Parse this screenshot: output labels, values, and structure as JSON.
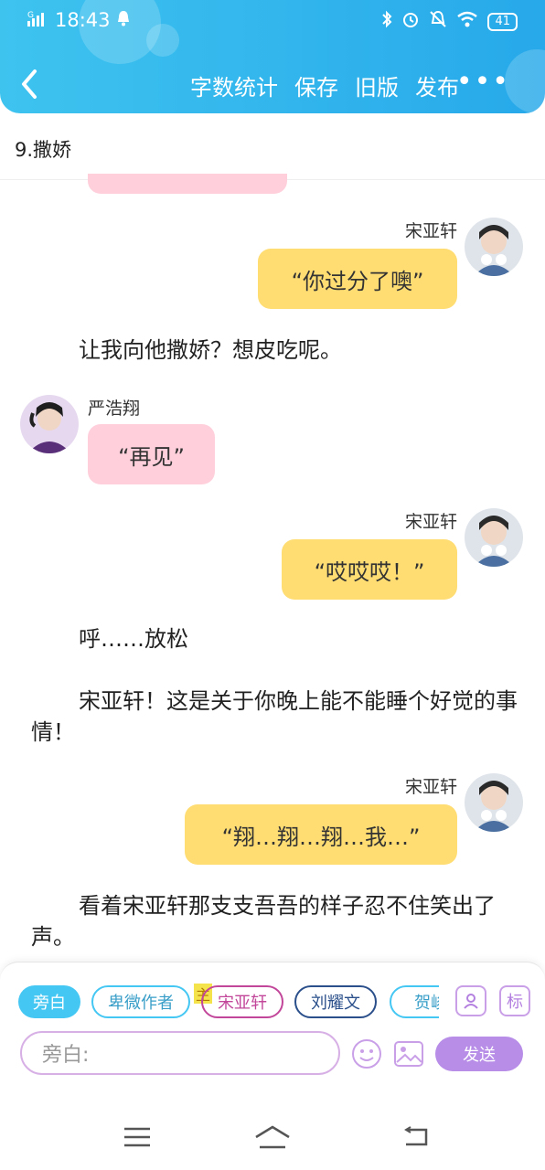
{
  "status_bar": {
    "signal": "ᴳ",
    "time": "18:43",
    "battery": "41"
  },
  "toolbar": {
    "word_count": "字数统计",
    "save": "保存",
    "old_version": "旧版",
    "publish": "发布"
  },
  "chapter_title": "9.撒娇",
  "messages": {
    "m1": {
      "speaker": "宋亚轩",
      "text": "“你过分了噢”"
    },
    "n1": "让我向他撒娇？想皮吃呢。",
    "m2": {
      "speaker": "严浩翔",
      "text": "“再见”"
    },
    "m3": {
      "speaker": "宋亚轩",
      "text": "“哎哎哎！”"
    },
    "n2": "呼……放松",
    "n3": "宋亚轩！这是关于你晚上能不能睡个好觉的事情！",
    "m4": {
      "speaker": "宋亚轩",
      "text": "“翔…翔…翔…我…”"
    },
    "n4": "看着宋亚轩那支支吾吾的样子忍不住笑出了声。"
  },
  "roles": {
    "narration": "旁白",
    "author": "卑微作者",
    "main_badge": "主",
    "r1": "宋亚轩",
    "r2": "刘耀文",
    "r3": "贺峻",
    "tag_button": "标"
  },
  "input": {
    "placeholder": "旁白:",
    "send": "发送"
  },
  "colors": {
    "header": "#27a9ea",
    "yellow_bubble": "#ffdd73",
    "pink_bubble": "#ffd0dc",
    "send": "#b78de8",
    "narration_chip": "#45c7f3"
  }
}
